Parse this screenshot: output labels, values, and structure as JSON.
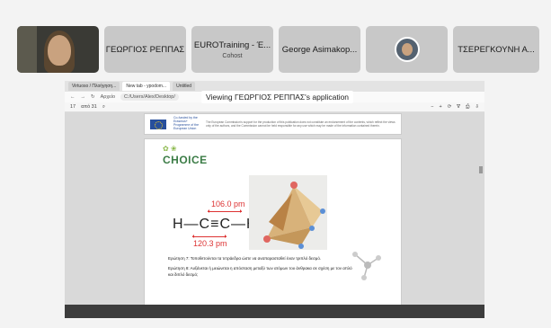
{
  "participants": [
    {
      "name": ""
    },
    {
      "name": "ΓΕΩΡΓΙΟΣ ΡΕΠΠΑΣ"
    },
    {
      "name": "EUROTraining - Έ...",
      "role": "Cohost"
    },
    {
      "name": "George Asimakop..."
    },
    {
      "name": ""
    },
    {
      "name": "ΤΣΕΡΕΓΚΟΥΝΗ Α..."
    }
  ],
  "viewing_banner": "Viewing ΓΕΩΡΓΙΟΣ ΡΕΠΠΑΣ's application",
  "browser": {
    "tabs": [
      "Virtuoso / Πλοήγηση...",
      "New tab - ypodom...",
      "Untitled"
    ],
    "address": "C:/Users/Alex/Desktop/",
    "app_label": "Αρχείο",
    "page_num": "17",
    "page_total": "από 31"
  },
  "pdf": {
    "eu_text": "Co-funded by the Erasmus+ Programme of the European Union",
    "disclaimer": "The European Commission's support for the production of this publication does not constitute an endorsement of the contents, which reflect the views only of the authors, and the Commission cannot be held responsible for any use which may be made of the information contained therein.",
    "logo": "CHOICE",
    "molecule": "H—C≡C—H",
    "dim_top": "106.0 pm",
    "dim_bottom": "120.3 pm",
    "question1": "Ερώτηση 7: Τοποθετούνται τα τετράεδρα ώστε να αναπαρασταθεί έναν τριπλό δεσμό.",
    "question2": "Ερώτηση 8: Αυξάνεται ή μειώνεται η απόσταση μεταξύ των ατόμων του άνθρακα σε σχέση με τον απλό και διπλό δεσμό;"
  }
}
